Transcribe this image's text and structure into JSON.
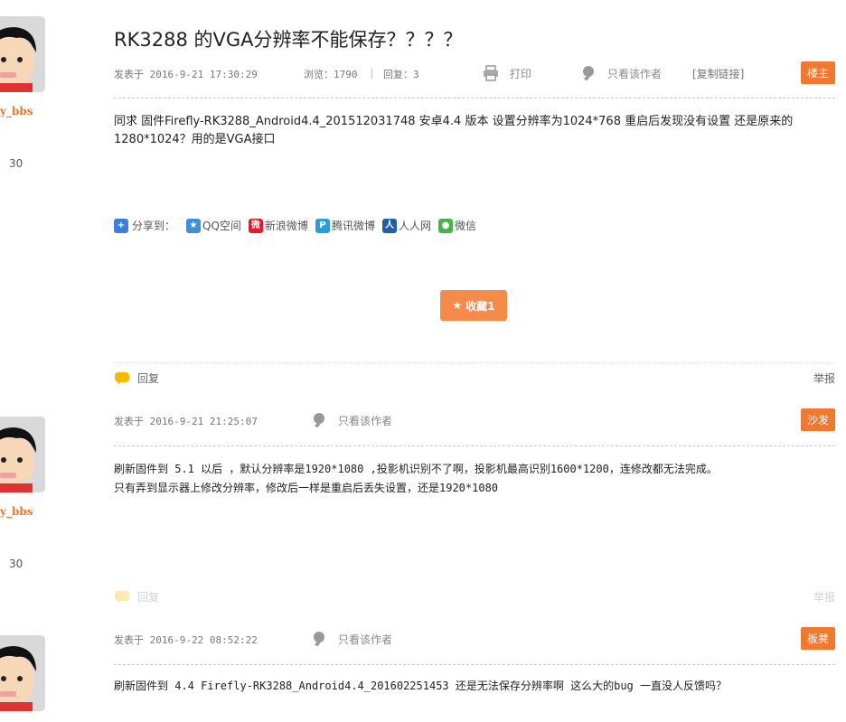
{
  "thread": {
    "title": "RK3288 的VGA分辨率不能保存？？？？",
    "views_label": "浏览：1790",
    "replies_label": "回复：3",
    "print_label": "打印",
    "author_only_label": "只看该作者",
    "copy_link_label": "[复制链接]"
  },
  "share": {
    "label": "分享到：",
    "items": [
      {
        "label": "QQ空间",
        "icon": "qzone-icon",
        "color": "#3d8fd8"
      },
      {
        "label": "新浪微博",
        "icon": "weibo-icon",
        "color": "#e6162d"
      },
      {
        "label": "腾讯微博",
        "icon": "tencent-weibo-icon",
        "color": "#2a9fd6"
      },
      {
        "label": "人人网",
        "icon": "renren-icon",
        "color": "#1f5ea8"
      },
      {
        "label": "微信",
        "icon": "wechat-icon",
        "color": "#44b549"
      }
    ]
  },
  "favorite": {
    "label": "收藏1"
  },
  "colors": {
    "accent": "#f07830",
    "username": "#e4782b"
  },
  "posts": [
    {
      "username": "y_bbs",
      "stat": "30",
      "posted": "发表于  2016-9-21 17:30:29",
      "floor": "楼主",
      "content_lines": [
        "同求 固件Firefly-RK3288_Android4.4_201512031748  安卓4.4 版本   设置分辨率为1024*768 重启后发现没有设置 还是原来的1280*1024？用的是VGA接口"
      ],
      "reply_label": "回复",
      "report_label": "举报"
    },
    {
      "username": "y_bbs",
      "stat": "30",
      "posted": "发表于  2016-9-21 21:25:07",
      "author_only": "只看该作者",
      "floor": "沙发",
      "content_lines": [
        "刷新固件到 5.1 以后 ，默认分辨率是1920*1080 ,投影机识别不了啊，投影机最高识别1600*1200，连修改都无法完成。",
        "只有弄到显示器上修改分辨率，修改后一样是重启后丢失设置，还是1920*1080"
      ],
      "reply_label": "回复",
      "report_label": "举报"
    },
    {
      "posted": "发表于  2016-9-22 08:52:22",
      "author_only": "只看该作者",
      "floor": "板凳",
      "content_lines": [
        "刷新固件到 4.4 Firefly-RK3288_Android4.4_201602251453 还是无法保存分辨率啊 这么大的bug 一直没人反馈吗？"
      ]
    }
  ]
}
